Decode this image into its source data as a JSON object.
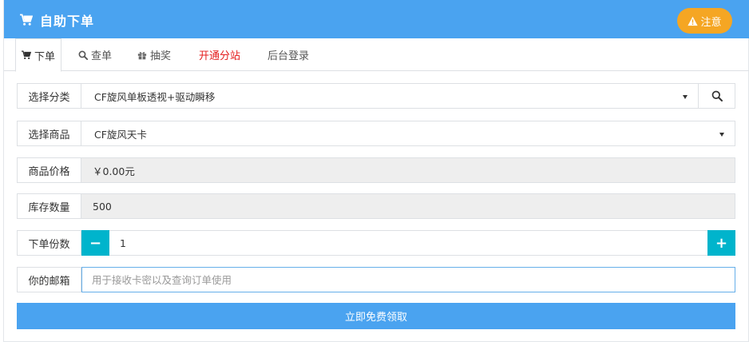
{
  "header": {
    "title": "自助下单",
    "notice_label": "注意",
    "colors": {
      "header_bg": "#4aa3f0",
      "notice_bg": "#f5a623"
    }
  },
  "tabs": [
    {
      "label": "下单",
      "icon": "cart-icon",
      "active": true
    },
    {
      "label": "查单",
      "icon": "search-icon"
    },
    {
      "label": "抽奖",
      "icon": "gift-icon"
    },
    {
      "label": "开通分站",
      "color": "#e41c1c"
    },
    {
      "label": "后台登录"
    }
  ],
  "form": {
    "category": {
      "label": "选择分类",
      "value": "CF旋风单板透视+驱动瞬移"
    },
    "product": {
      "label": "选择商品",
      "value": "CF旋风天卡"
    },
    "price": {
      "label": "商品价格",
      "value": "￥0.00元"
    },
    "stock": {
      "label": "库存数量",
      "value": "500"
    },
    "quantity": {
      "label": "下单份数",
      "value": "1",
      "minus": "−",
      "plus": "+"
    },
    "email": {
      "label": "你的邮箱",
      "placeholder": "用于接收卡密以及查询订单使用",
      "value": ""
    }
  },
  "submit_label": "立即免费领取"
}
